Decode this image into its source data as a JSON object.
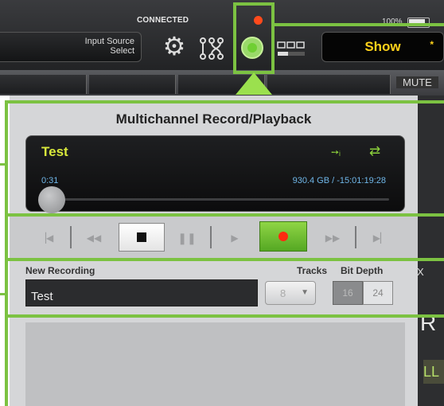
{
  "status": {
    "connection": "CONNECTED",
    "battery": "100%"
  },
  "toolbar": {
    "input_source_line1": "Input Source",
    "input_source_line2": "Select",
    "gear_icon": "gear-icon",
    "routing_icon": "routing-icon",
    "record_icon": "record-icon",
    "meters_icon": "meters-icon",
    "show_label": "Show",
    "show_star": "*"
  },
  "strip": {
    "mute_label": "MUTE"
  },
  "right_edge": {
    "x_label": "X",
    "r_label": "R",
    "ll_label": "LL"
  },
  "recorder": {
    "title": "Multichannel Record/Playback",
    "track_name": "Test",
    "elapsed": "0:31",
    "disk_info": "930.4 GB / -15:01:19:28"
  },
  "transport": {
    "buttons": [
      "skip-back",
      "rewind",
      "stop",
      "pause",
      "play",
      "record",
      "fast-forward",
      "skip-forward"
    ]
  },
  "new_recording": {
    "label": "New Recording",
    "value": "Test",
    "tracks_label": "Tracks",
    "tracks_value": "8",
    "bit_depth_label": "Bit Depth",
    "bit_depth_options": [
      "16",
      "24"
    ]
  },
  "colors": {
    "accent": "#7cc242",
    "record": "#ff2a10",
    "track_name": "#d8e83b",
    "info_text": "#6fb6e8",
    "show_text": "#ffd21a"
  }
}
